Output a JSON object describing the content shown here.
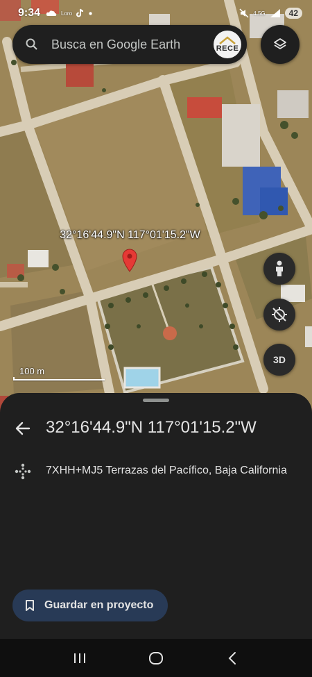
{
  "status_bar": {
    "time": "9:34",
    "carrier_text": "Loro",
    "network": "4.5G",
    "battery": "42"
  },
  "search": {
    "placeholder": "Busca en Google Earth",
    "profile_logo_text": "RECE"
  },
  "map": {
    "coordinate_label": "32°16'44.9\"N 117°01'15.2\"W",
    "scale_label": "100 m",
    "button_3d_label": "3D"
  },
  "sheet": {
    "title": "32°16'44.9\"N 117°01'15.2\"W",
    "plus_code": "7XHH+MJ5 Terrazas del Pacífico, Baja California",
    "save_button_label": "Guardar en proyecto"
  },
  "icons": {
    "search": "search-icon",
    "layers": "layers-icon",
    "pegman": "pegman-icon",
    "compass": "compass-off-icon",
    "pin": "map-pin-icon",
    "back": "back-arrow-icon",
    "plus_code": "plus-code-icon",
    "bookmark": "bookmark-icon"
  },
  "colors": {
    "pin_red": "#e53935",
    "panel_bg": "#1f1f1f",
    "save_button_bg": "#283a56"
  }
}
